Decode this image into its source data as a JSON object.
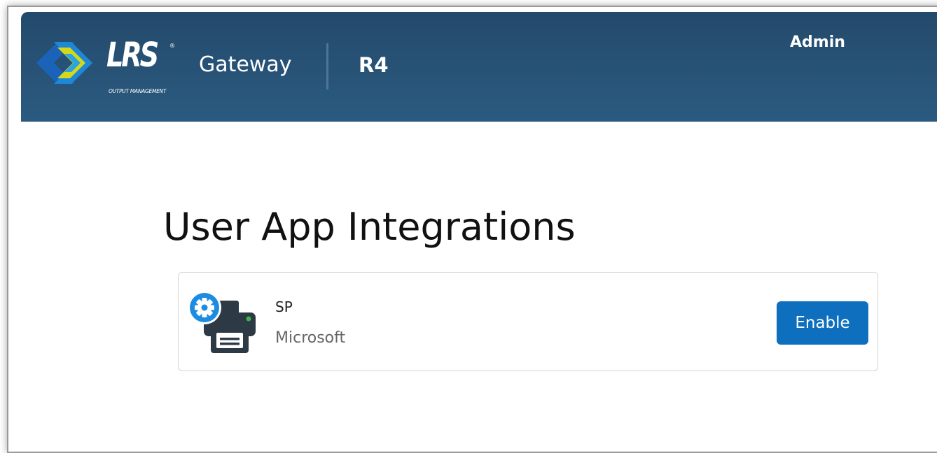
{
  "header": {
    "brand": "LRS",
    "brand_registered": "®",
    "brand_subtitle": "OUTPUT MANAGEMENT",
    "product": "Gateway",
    "version": "R4",
    "user_menu": "Admin"
  },
  "main": {
    "title": "User App Integrations",
    "integrations": [
      {
        "name": "SP",
        "vendor": "Microsoft",
        "action_label": "Enable",
        "icon": "printer-gear-icon"
      }
    ]
  },
  "colors": {
    "header_bg": "#2b5a80",
    "button_bg": "#0d6fbd",
    "logo_blue": "#1a63b8",
    "logo_yellow": "#d4d81a",
    "icon_gear": "#1d8ce0",
    "icon_printer": "#2d3a45",
    "icon_led": "#3bb54a"
  }
}
